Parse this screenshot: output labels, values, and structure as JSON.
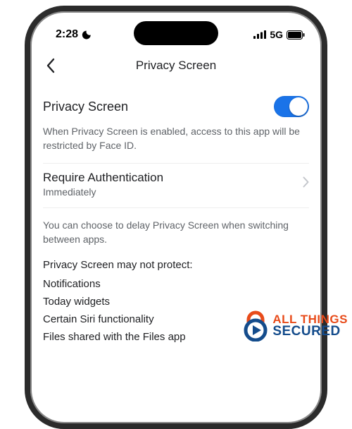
{
  "statusbar": {
    "time": "2:28",
    "network": "5G"
  },
  "nav": {
    "title": "Privacy Screen"
  },
  "toggle": {
    "label": "Privacy Screen",
    "on": true,
    "description": "When Privacy Screen is enabled, access to this app will be restricted by Face ID."
  },
  "require_auth": {
    "title": "Require Authentication",
    "value": "Immediately",
    "description": "You can choose to delay Privacy Screen when switching between apps."
  },
  "warning": {
    "heading": "Privacy Screen may not protect:",
    "items": [
      "Notifications",
      "Today widgets",
      "Certain Siri functionality",
      "Files shared with the Files app"
    ]
  },
  "watermark": {
    "line1": "ALL THINGS",
    "line2": "SECURED"
  }
}
